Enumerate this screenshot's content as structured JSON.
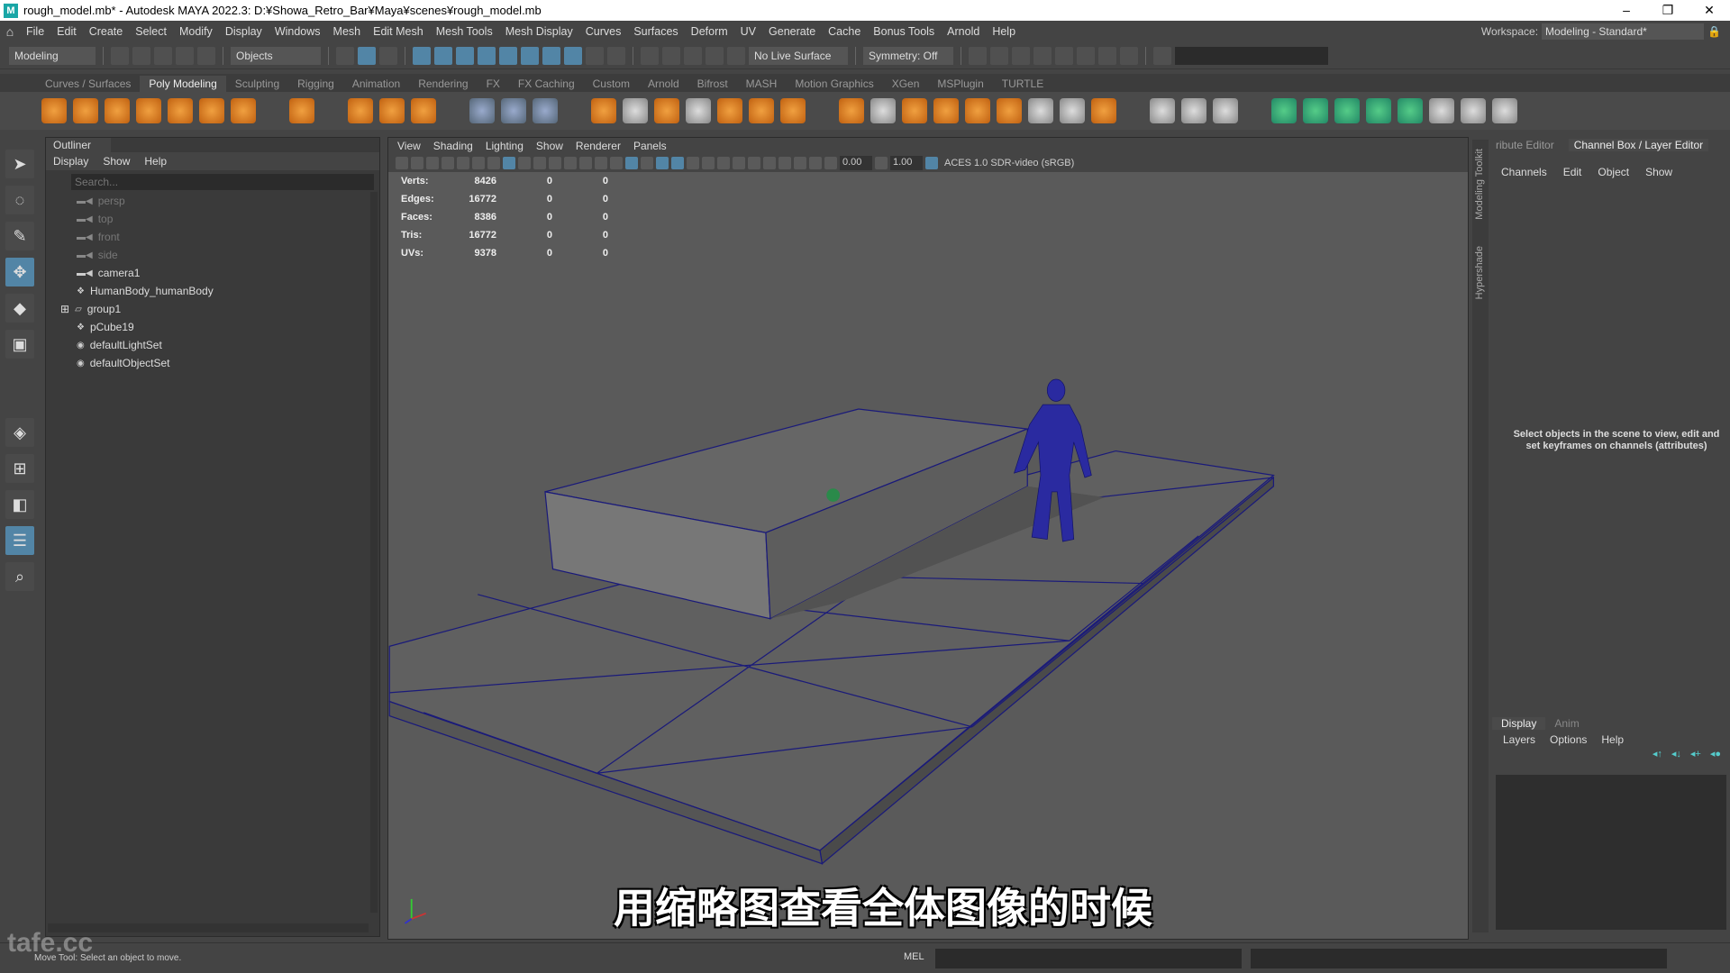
{
  "window": {
    "title": "rough_model.mb* - Autodesk MAYA 2022.3: D:¥Showa_Retro_Bar¥Maya¥scenes¥rough_model.mb",
    "controls": [
      "–",
      "❐",
      "✕"
    ]
  },
  "menubar": {
    "items": [
      "File",
      "Edit",
      "Create",
      "Select",
      "Modify",
      "Display",
      "Windows",
      "Mesh",
      "Edit Mesh",
      "Mesh Tools",
      "Mesh Display",
      "Curves",
      "Surfaces",
      "Deform",
      "UV",
      "Generate",
      "Cache",
      "Bonus Tools",
      "Arnold",
      "Help"
    ],
    "workspace_label": "Workspace:",
    "workspace_value": "Modeling - Standard*"
  },
  "statusline": {
    "menuset": "Modeling",
    "select_mode": "Objects",
    "live_surface": "No Live Surface",
    "symmetry": "Symmetry: Off"
  },
  "shelf": {
    "tabs": [
      "Curves / Surfaces",
      "Poly Modeling",
      "Sculpting",
      "Rigging",
      "Animation",
      "Rendering",
      "FX",
      "FX Caching",
      "Custom",
      "Arnold",
      "Bifrost",
      "MASH",
      "Motion Graphics",
      "XGen",
      "MSPlugin",
      "TURTLE"
    ],
    "active": "Poly Modeling"
  },
  "outliner": {
    "title": "Outliner",
    "menu": [
      "Display",
      "Show",
      "Help"
    ],
    "search_placeholder": "Search...",
    "items": [
      {
        "label": "persp",
        "type": "camera",
        "dim": true
      },
      {
        "label": "top",
        "type": "camera",
        "dim": true
      },
      {
        "label": "front",
        "type": "camera",
        "dim": true
      },
      {
        "label": "side",
        "type": "camera",
        "dim": true
      },
      {
        "label": "camera1",
        "type": "camera",
        "dim": false
      },
      {
        "label": "HumanBody_humanBody",
        "type": "mesh",
        "dim": false
      },
      {
        "label": "group1",
        "type": "group",
        "dim": false
      },
      {
        "label": "pCube19",
        "type": "mesh",
        "dim": false
      },
      {
        "label": "defaultLightSet",
        "type": "set",
        "dim": false
      },
      {
        "label": "defaultObjectSet",
        "type": "set",
        "dim": false
      }
    ]
  },
  "viewport": {
    "menu": [
      "View",
      "Shading",
      "Lighting",
      "Show",
      "Renderer",
      "Panels"
    ],
    "exposure": "0.00",
    "gamma": "1.00",
    "color_space": "ACES 1.0 SDR-video (sRGB)",
    "hud": [
      {
        "label": "Verts:",
        "value": "8426",
        "a": "0",
        "b": "0"
      },
      {
        "label": "Edges:",
        "value": "16772",
        "a": "0",
        "b": "0"
      },
      {
        "label": "Faces:",
        "value": "8386",
        "a": "0",
        "b": "0"
      },
      {
        "label": "Tris:",
        "value": "16772",
        "a": "0",
        "b": "0"
      },
      {
        "label": "UVs:",
        "value": "9378",
        "a": "0",
        "b": "0"
      }
    ],
    "subtitle": "用缩略图查看全体图像的时候",
    "wire_color": "#1a1a7a",
    "figure_color": "#2a2aa0"
  },
  "side_tabs": [
    "Modeling Toolkit",
    "Hypershade"
  ],
  "channelbox": {
    "tabs": [
      "ribute Editor",
      "Channel Box / Layer Editor"
    ],
    "menu": [
      "Channels",
      "Edit",
      "Object",
      "Show"
    ],
    "message": "Select objects in the scene to view, edit and set keyframes on channels (attributes)"
  },
  "layereditor": {
    "tabs": [
      "Display",
      "Anim"
    ],
    "menu": [
      "Layers",
      "Options",
      "Help"
    ]
  },
  "helpline": {
    "message": "Move Tool: Select an object to move.",
    "mel_label": "MEL"
  },
  "watermark": "tafe.cc"
}
